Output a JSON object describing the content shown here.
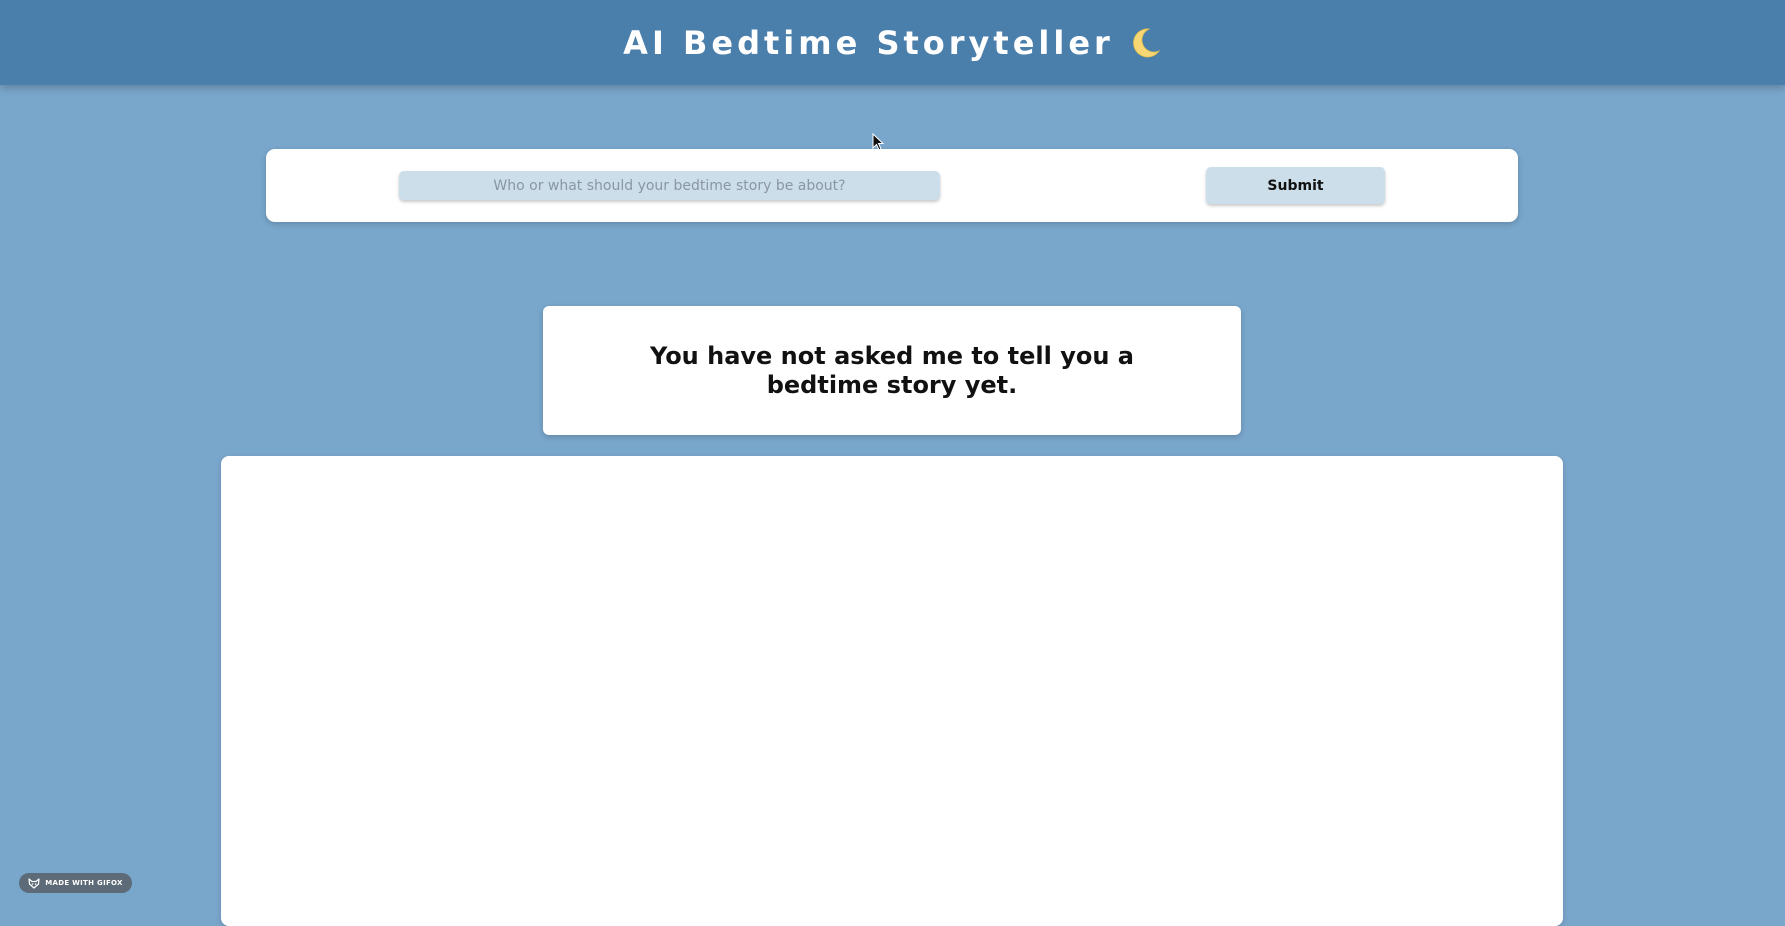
{
  "header": {
    "title": "AI Bedtime Storyteller",
    "icon": "crescent-moon-icon"
  },
  "form": {
    "input_placeholder": "Who or what should your bedtime story be about?",
    "input_value": "",
    "submit_label": "Submit"
  },
  "status": {
    "message": "You have not asked me to tell you a bedtime story yet."
  },
  "story": {
    "text": ""
  },
  "badge": {
    "label": "MADE WITH GIFOX",
    "icon": "gifox-fox-icon"
  },
  "colors": {
    "page_background": "#79a6cb",
    "header_background": "#4a7eab",
    "input_background": "#ccdeea",
    "card_background": "#ffffff"
  }
}
